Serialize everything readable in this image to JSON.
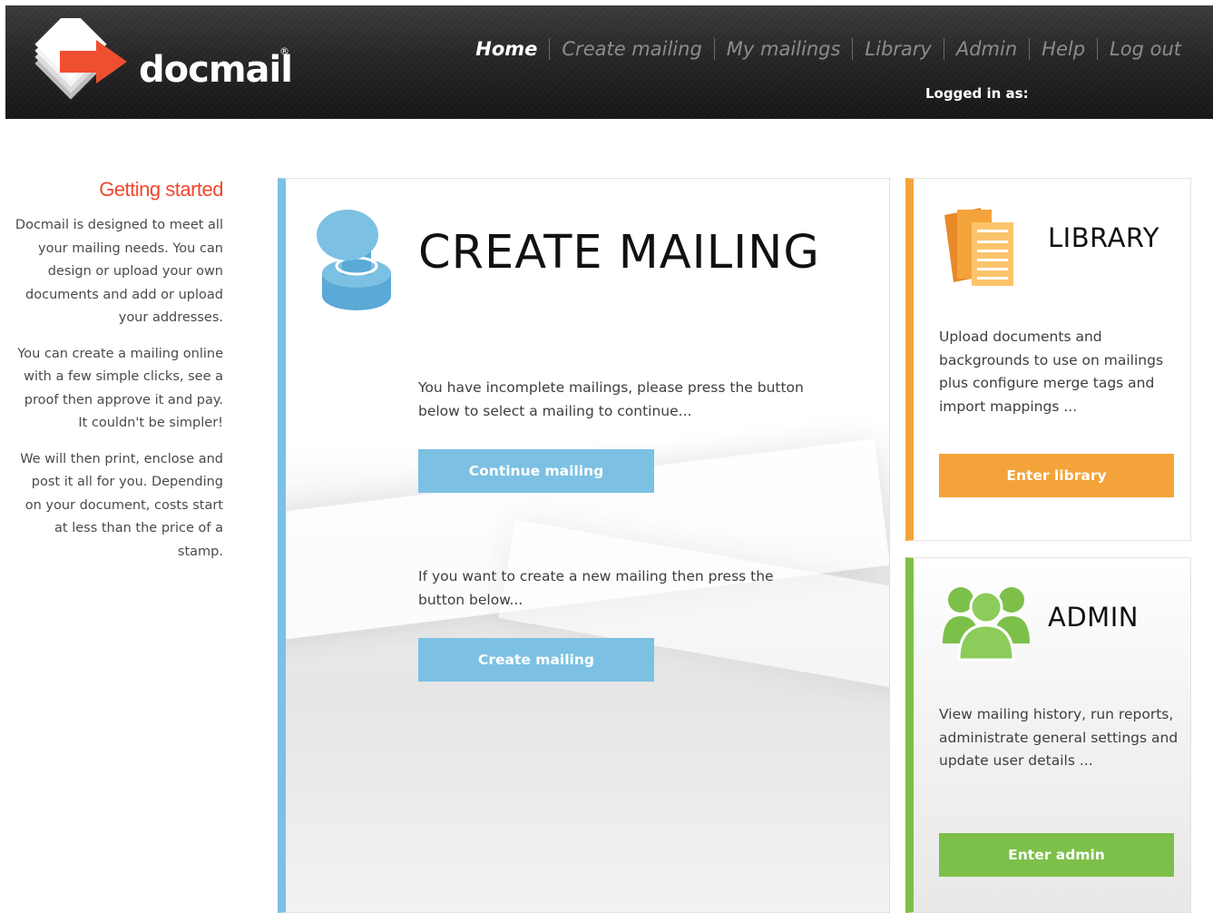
{
  "brand": {
    "name": "docmail",
    "registered": "®"
  },
  "nav": {
    "items": [
      {
        "label": "Home",
        "active": true
      },
      {
        "label": "Create mailing"
      },
      {
        "label": "My mailings"
      },
      {
        "label": "Library"
      },
      {
        "label": "Admin"
      },
      {
        "label": "Help"
      },
      {
        "label": "Log out"
      }
    ]
  },
  "logged_in": "Logged in as:",
  "sidebar": {
    "title": "Getting started",
    "paragraphs": [
      "Docmail is designed to meet all your mailing needs. You can design or upload your own documents and add or upload your addresses.",
      "You can create a mailing online with a few simple clicks, see a proof then approve it and pay. It couldn't be simpler!",
      "We will then print, enclose and post it all for you. Depending on your document, costs start at less than the price of a stamp."
    ]
  },
  "create_mailing": {
    "title": "CREATE MAILING",
    "incomplete_text": "You have incomplete mailings, please press the button below to select a mailing to continue...",
    "continue_label": "Continue mailing",
    "new_text": "If you want to create a new mailing then press the button below...",
    "create_label": "Create mailing"
  },
  "library": {
    "title": "LIBRARY",
    "text": "Upload documents and backgrounds to use on mailings plus configure merge tags and import mappings ...",
    "button_label": "Enter library"
  },
  "admin": {
    "title": "ADMIN",
    "text": "View mailing history, run reports, administrate general settings and update user details ...",
    "button_label": "Enter admin"
  },
  "colors": {
    "header_bg": "#1e1e1e",
    "sidebar_title": "#f0472e",
    "create_accent": "#7cc1e3",
    "library_accent": "#f4a33a",
    "admin_accent": "#7cc04a"
  },
  "icons": {
    "logo": "docmail-arrow-logo",
    "create": "stamp-icon",
    "library": "documents-icon",
    "admin": "users-group-icon"
  }
}
